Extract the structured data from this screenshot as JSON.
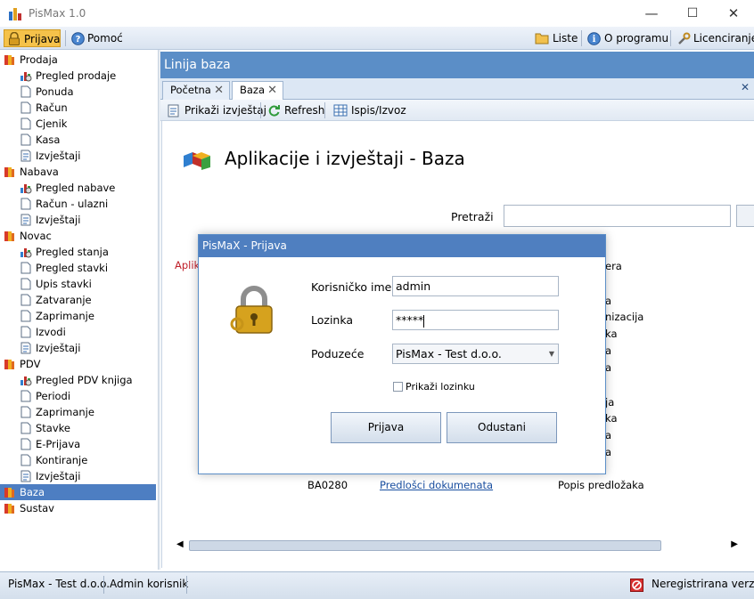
{
  "window": {
    "title": "PisMax 1.0",
    "minimize": "—",
    "maximize": "☐",
    "close": "✕"
  },
  "toolbar": {
    "login": "Prijava",
    "help": "Pomoć",
    "lists": "Liste",
    "about": "O programu",
    "licensing": "Licenciranje"
  },
  "sidebar": {
    "items": [
      {
        "label": "Prodaja",
        "level": 0,
        "icon": "folder-icon"
      },
      {
        "label": "Pregled prodaje",
        "level": 1,
        "icon": "chart-icon"
      },
      {
        "label": "Ponuda",
        "level": 1,
        "icon": "document-icon"
      },
      {
        "label": "Račun",
        "level": 1,
        "icon": "document-icon"
      },
      {
        "label": "Cjenik",
        "level": 1,
        "icon": "document-icon"
      },
      {
        "label": "Kasa",
        "level": 1,
        "icon": "document-icon"
      },
      {
        "label": "Izvještaji",
        "level": 1,
        "icon": "report-icon"
      },
      {
        "label": "Nabava",
        "level": 0,
        "icon": "folder-icon"
      },
      {
        "label": "Pregled nabave",
        "level": 1,
        "icon": "chart-icon"
      },
      {
        "label": "Račun - ulazni",
        "level": 1,
        "icon": "document-icon"
      },
      {
        "label": "Izvještaji",
        "level": 1,
        "icon": "report-icon"
      },
      {
        "label": "Novac",
        "level": 0,
        "icon": "folder-icon"
      },
      {
        "label": "Pregled stanja",
        "level": 1,
        "icon": "chart-icon"
      },
      {
        "label": "Pregled stavki",
        "level": 1,
        "icon": "document-icon"
      },
      {
        "label": "Upis stavki",
        "level": 1,
        "icon": "document-icon"
      },
      {
        "label": "Zatvaranje",
        "level": 1,
        "icon": "document-icon"
      },
      {
        "label": "Zaprimanje",
        "level": 1,
        "icon": "document-icon"
      },
      {
        "label": "Izvodi",
        "level": 1,
        "icon": "document-icon"
      },
      {
        "label": "Izvještaji",
        "level": 1,
        "icon": "report-icon"
      },
      {
        "label": "PDV",
        "level": 0,
        "icon": "folder-icon"
      },
      {
        "label": "Pregled PDV knjiga",
        "level": 1,
        "icon": "chart-icon"
      },
      {
        "label": "Periodi",
        "level": 1,
        "icon": "document-icon"
      },
      {
        "label": "Zaprimanje",
        "level": 1,
        "icon": "document-icon"
      },
      {
        "label": "Stavke",
        "level": 1,
        "icon": "document-icon"
      },
      {
        "label": "E-Prijava",
        "level": 1,
        "icon": "document-icon"
      },
      {
        "label": "Kontiranje",
        "level": 1,
        "icon": "document-icon"
      },
      {
        "label": "Izvještaji",
        "level": 1,
        "icon": "report-icon"
      },
      {
        "label": "Baza",
        "level": 0,
        "icon": "folder-icon",
        "selected": true
      },
      {
        "label": "Sustav",
        "level": 0,
        "icon": "folder-icon"
      }
    ]
  },
  "main": {
    "header": "Linija baza",
    "tabs": [
      {
        "label": "Početna"
      },
      {
        "label": "Baza"
      }
    ],
    "subtoolbar": {
      "show_report": "Prikaži izvještaj",
      "refresh": "Refresh",
      "print": "Ispis/Izvoz"
    },
    "page_title": "Aplikacije i izvještaji - Baza",
    "search_label": "Pretraži",
    "background_fragments": {
      "red_left": "Aplik",
      "right_col": [
        "era",
        "a",
        "nizacija",
        "ka",
        "a",
        "a",
        "ja",
        "ka",
        "a",
        "a"
      ],
      "last_row": {
        "code": "BA0280",
        "link": "Predlošci dokumenata",
        "desc": "Popis predložaka"
      }
    }
  },
  "dialog": {
    "title": "PisMaX - Prijava",
    "username_label": "Korisničko ime",
    "username_value": "admin",
    "password_label": "Lozinka",
    "password_value": "*****",
    "company_label": "Poduzeće",
    "company_value": "PisMax - Test d.o.o.",
    "show_password_label": "Prikaži lozinku",
    "login_button": "Prijava",
    "cancel_button": "Odustani"
  },
  "status": {
    "company": "PisMax - Test d.o.o.",
    "user": "Admin korisnik",
    "registration": "Neregistrirana verzija"
  },
  "colors": {
    "header_blue": "#5b8ec7",
    "selected_blue": "#4d7ec2",
    "link_blue": "#1a4fa0",
    "alert_red": "#c0202a"
  }
}
